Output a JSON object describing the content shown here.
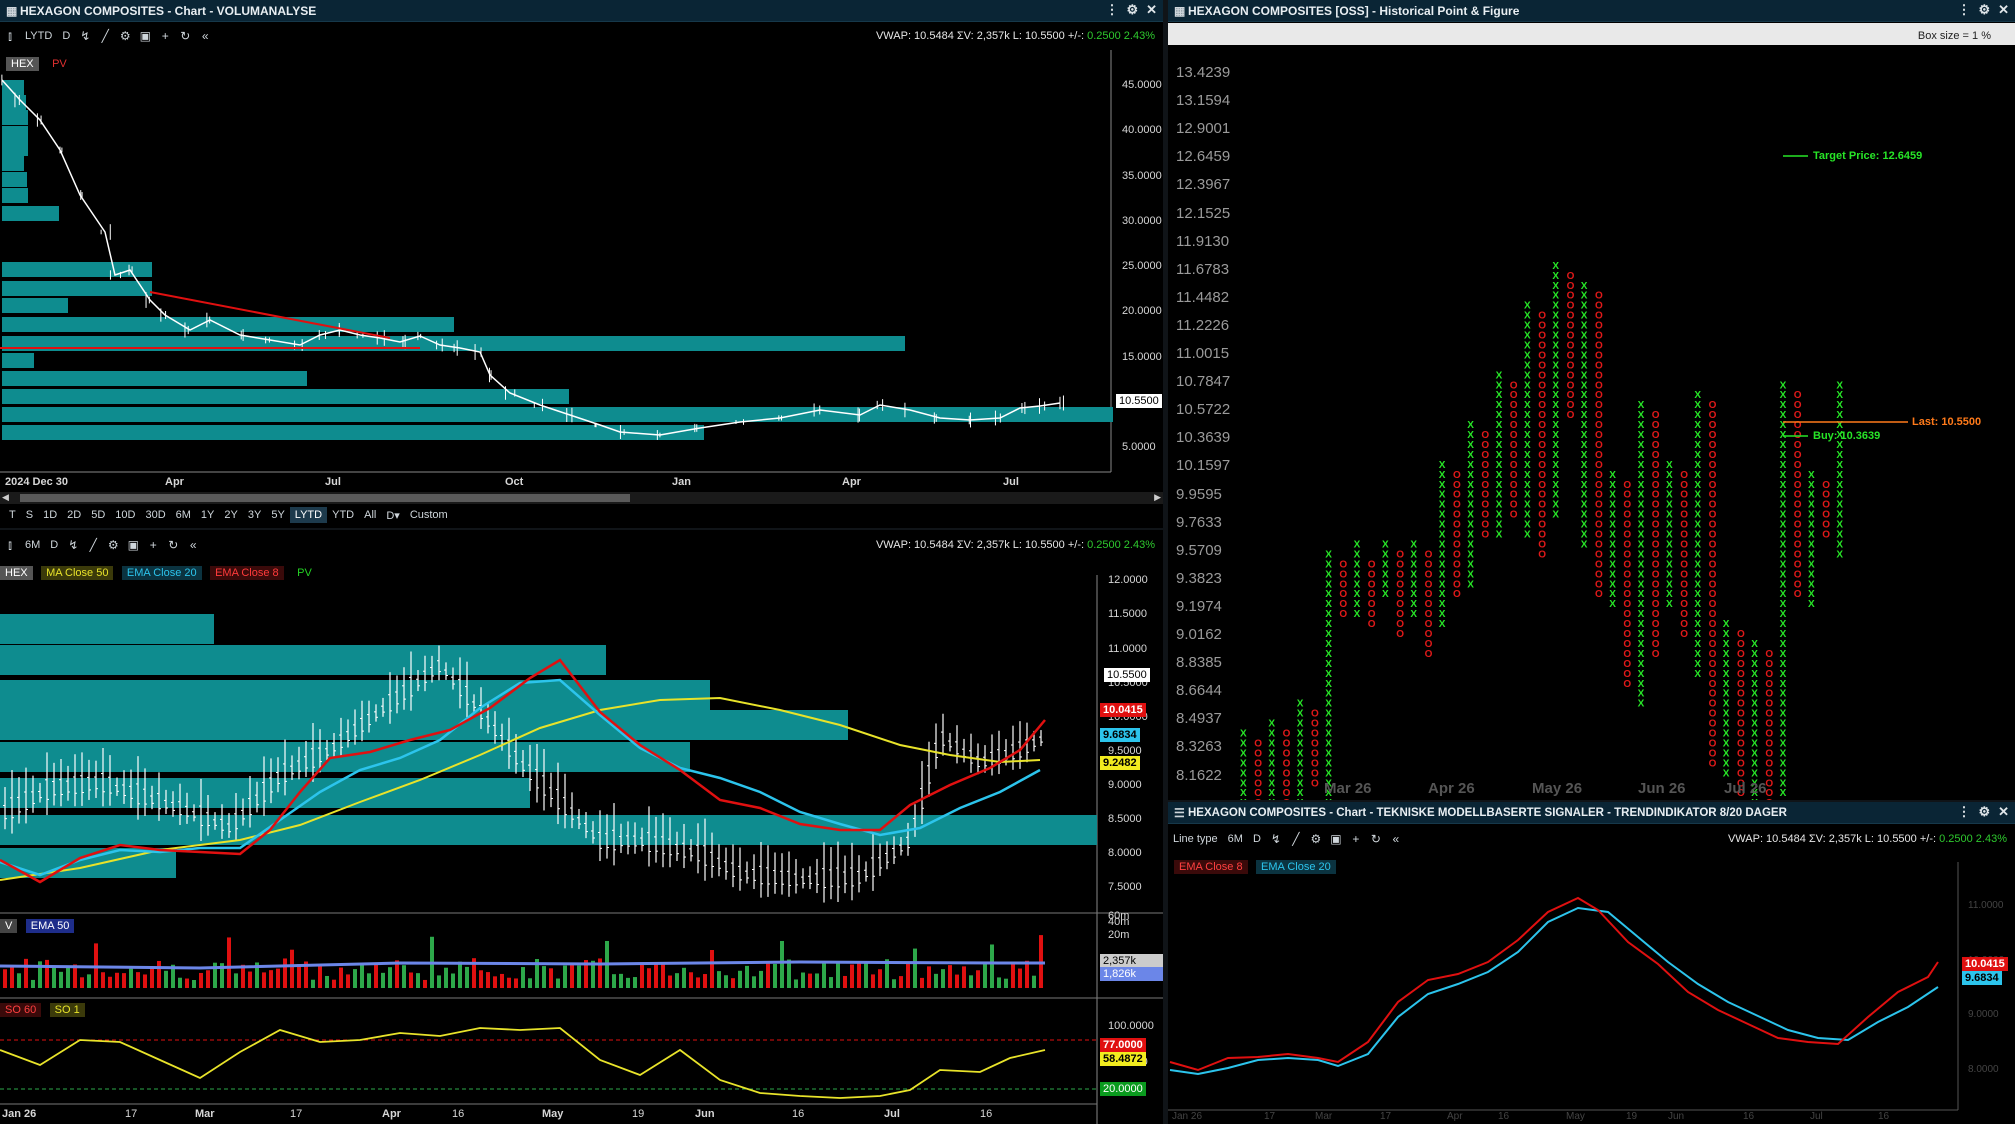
{
  "colors": {
    "accent_teal": "#0e8c8f",
    "red": "#e01010",
    "cyan": "#2cc4ec",
    "yellow": "#e8e32a",
    "green": "#24d124",
    "pnf_x": "#27e527",
    "pnf_o": "#e01919",
    "titlebar": "#0a2535"
  },
  "vol_chart": {
    "title": "HEXAGON COMPOSITES - Chart - VOLUMANALYSE",
    "toolbar": {
      "period": "LYTD",
      "interval": "D"
    },
    "vwap": {
      "text": "VWAP: 10.5484  ΣV: 2,357k  L: 10.5500  +/-: ",
      "chg": "0.2500  2.43%"
    },
    "tags": [
      "HEX",
      "PV"
    ],
    "y_labels": [
      "45.0000",
      "40.0000",
      "35.0000",
      "30.0000",
      "25.0000",
      "20.0000",
      "15.0000",
      "10.0000",
      "5.0000"
    ],
    "last_price": "10.5500",
    "x_labels": [
      "2024 Dec 30",
      "Apr",
      "Jul",
      "Oct",
      "Jan",
      "Apr",
      "Jul"
    ],
    "periods": [
      "T",
      "S",
      "1D",
      "2D",
      "5D",
      "10D",
      "30D",
      "6M",
      "1Y",
      "2Y",
      "3Y",
      "5Y",
      "LYTD",
      "YTD",
      "All",
      "D▾",
      "Custom"
    ],
    "selected_period": "LYTD"
  },
  "ind_chart": {
    "toolbar": {
      "period": "6M",
      "interval": "D"
    },
    "vwap": {
      "text": "VWAP: 10.5484  ΣV: 2,357k  L: 10.5500  +/-: ",
      "chg": "0.2500  2.43%"
    },
    "tags": [
      "HEX",
      "MA Close 50",
      "EMA Close 20",
      "EMA Close 8",
      "PV"
    ],
    "y_labels": [
      "12.0000",
      "11.5000",
      "11.0000",
      "10.5000",
      "10.0000",
      "9.5000",
      "9.0000",
      "8.5000",
      "8.0000",
      "7.5000"
    ],
    "price_boxes": {
      "last": "10.5500",
      "ema8": "10.0415",
      "ema20": "9.6834",
      "ma50": "9.2482"
    },
    "volume": {
      "tags": [
        "V",
        "EMA 50"
      ],
      "labels": [
        "60m",
        "40m",
        "20m"
      ],
      "box1": "2,357k",
      "box2": "1,826k"
    },
    "stoch": {
      "tags": [
        "SO 60",
        "SO 1"
      ],
      "labels": [
        "100.0000",
        "80.0000",
        "20.0000"
      ],
      "box1": "77.0000",
      "box2": "58.4872"
    },
    "x_labels": [
      "Jan 26",
      "17",
      "Mar",
      "17",
      "Apr",
      "16",
      "May",
      "19",
      "Jun",
      "16",
      "Jul",
      "16"
    ]
  },
  "pnf": {
    "title": "HEXAGON COMPOSITES [OSS] - Historical Point & Figure",
    "box_size": "Box size = 1 %",
    "y_labels": [
      "13.4239",
      "13.1594",
      "12.9001",
      "12.6459",
      "12.3967",
      "12.1525",
      "11.9130",
      "11.6783",
      "11.4482",
      "11.2226",
      "11.0015",
      "10.7847",
      "10.5722",
      "10.3639",
      "10.1597",
      "9.9595",
      "9.7633",
      "9.5709",
      "9.3823",
      "9.1974",
      "9.0162",
      "8.8385",
      "8.6644",
      "8.4937",
      "8.3263",
      "8.1622"
    ],
    "target": "Target Price: 12.6459",
    "last": "Last: 10.5500",
    "buy": "Buy: 10.3639",
    "x_labels": [
      "Mar 26",
      "Apr 26",
      "May 26",
      "Jun 26",
      "Jul 26"
    ]
  },
  "signal_chart": {
    "title": "HEXAGON COMPOSITES - Chart - TEKNISKE MODELLBASERTE SIGNALER - TRENDINDIKATOR 8/20 DAGER",
    "toolbar": {
      "linetype": "Line type",
      "period": "6M",
      "interval": "D"
    },
    "vwap": {
      "text": "VWAP: 10.5484  ΣV: 2,357k  L: 10.5500  +/-: ",
      "chg": "0.2500  2.43%"
    },
    "tags": [
      "EMA Close 8",
      "EMA Close 20"
    ],
    "y_labels": [
      "11.0000",
      "10.0000",
      "9.0000",
      "8.0000"
    ],
    "boxes": {
      "ema8": "10.0415",
      "ema20": "9.6834"
    },
    "x_labels": [
      "Jan 26",
      "17",
      "Mar",
      "17",
      "Apr",
      "16",
      "May",
      "19",
      "Jun",
      "16",
      "Jul",
      "16"
    ]
  }
}
